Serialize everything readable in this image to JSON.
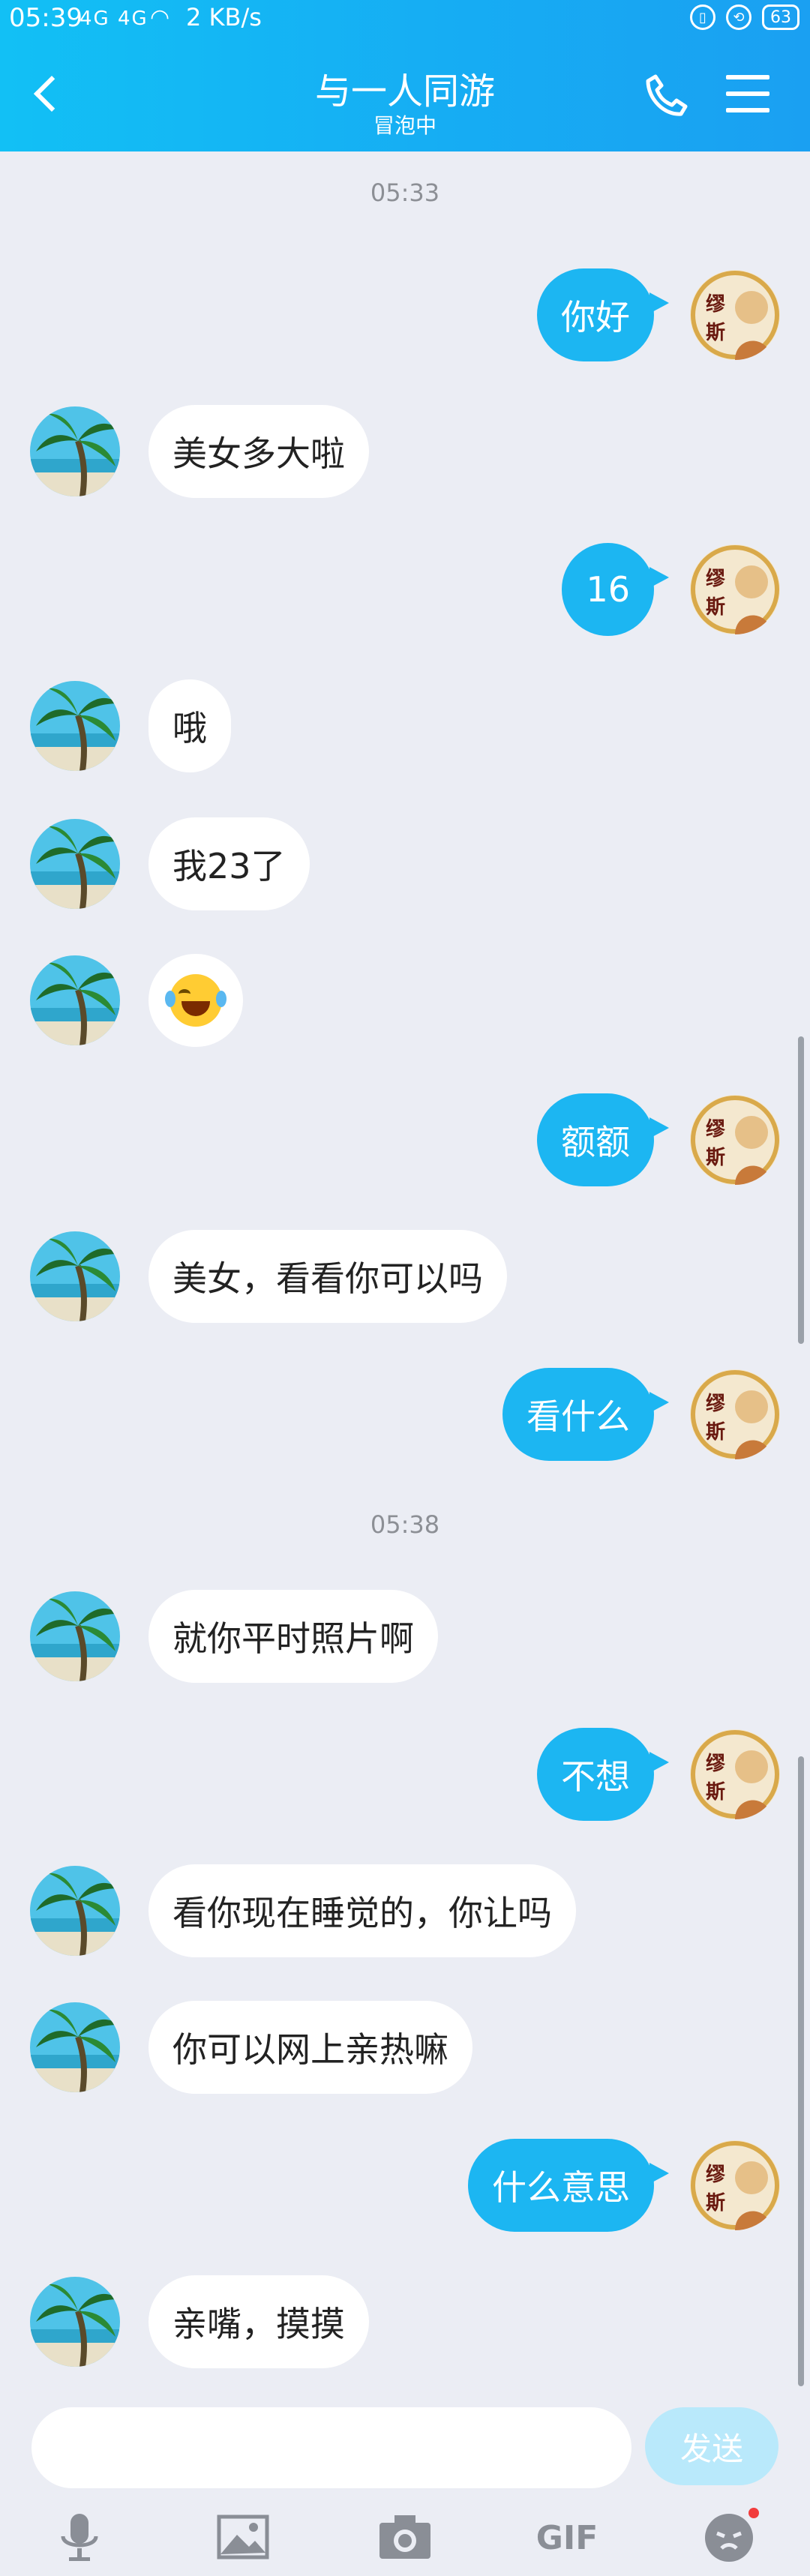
{
  "status_bar": {
    "time": "05:39",
    "signal": "4G 4G",
    "network_speed": "2 KB/s",
    "battery": "63"
  },
  "header": {
    "title": "与一人同游",
    "subtitle": "冒泡中"
  },
  "messages": [
    {
      "type": "timestamp",
      "text": "05:33"
    },
    {
      "type": "out",
      "text": "你好"
    },
    {
      "type": "in",
      "text": "美女多大啦"
    },
    {
      "type": "out",
      "text": "16"
    },
    {
      "type": "in",
      "text": "哦"
    },
    {
      "type": "in",
      "text": "我23了"
    },
    {
      "type": "in",
      "emoji": "face-with-tears-of-joy-icon"
    },
    {
      "type": "out",
      "text": "额额"
    },
    {
      "type": "in",
      "text": "美女，看看你可以吗"
    },
    {
      "type": "out",
      "text": "看什么"
    },
    {
      "type": "timestamp",
      "text": "05:38"
    },
    {
      "type": "in",
      "text": "就你平时照片啊"
    },
    {
      "type": "out",
      "text": "不想"
    },
    {
      "type": "in",
      "text": "看你现在睡觉的，你让吗"
    },
    {
      "type": "in",
      "text": "你可以网上亲热嘛"
    },
    {
      "type": "out",
      "text": "什么意思"
    },
    {
      "type": "in",
      "text": "亲嘴，摸摸"
    }
  ],
  "self_avatar_text": "缪斯",
  "input": {
    "placeholder": "",
    "send_label": "发送"
  },
  "toolbar": {
    "gif_label": "GIF"
  },
  "colors": {
    "header": "#16adf3",
    "outgoing_bubble": "#1cb6f2",
    "incoming_bubble": "#ffffff",
    "send_disabled": "#b9e9fb"
  }
}
